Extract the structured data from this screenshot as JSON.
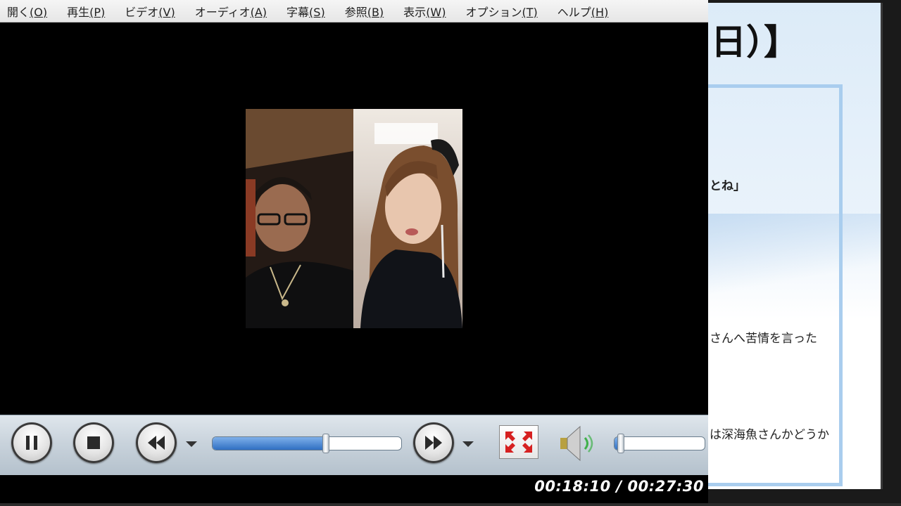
{
  "player": {
    "menu": [
      {
        "label": "開く",
        "key": "(O)"
      },
      {
        "label": "再生",
        "key": "(P)"
      },
      {
        "label": "ビデオ",
        "key": "(V)"
      },
      {
        "label": "オーディオ",
        "key": "(A)"
      },
      {
        "label": "字幕",
        "key": "(S)"
      },
      {
        "label": "参照",
        "key": "(B)"
      },
      {
        "label": "表示",
        "key": "(W)"
      },
      {
        "label": "オプション",
        "key": "(T)"
      },
      {
        "label": "ヘルプ",
        "key": "(H)"
      }
    ],
    "seek_progress": 0.6,
    "volume_level": 0.08,
    "time_display": "00:18:10 / 00:27:30",
    "colors": {
      "accent": "#2f6fc2",
      "video_bg": "#000000"
    }
  },
  "background_doc": {
    "heading": "日）】",
    "lines": [
      "とね」",
      "さんへ苦情を言った",
      "は深海魚さんかどうか"
    ]
  }
}
